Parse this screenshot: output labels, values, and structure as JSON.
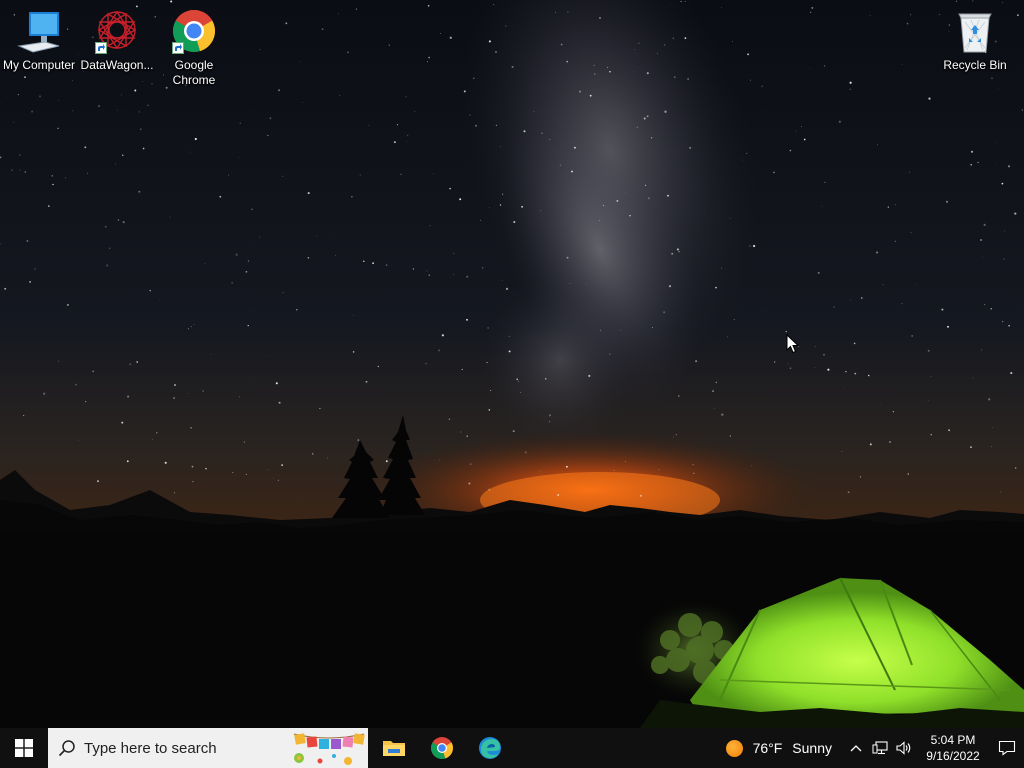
{
  "desktop": {
    "icons": [
      {
        "label": "My Computer",
        "icon": "monitor-icon"
      },
      {
        "label": "DataWagon...",
        "icon": "datawagon-icon"
      },
      {
        "label": "Google Chrome",
        "icon": "chrome-icon"
      },
      {
        "label": "Recycle Bin",
        "icon": "recycle-bin-icon"
      }
    ]
  },
  "taskbar": {
    "start_icon": "windows-logo-icon",
    "search_placeholder": "Type here to search",
    "pinned": [
      {
        "name": "File Explorer",
        "icon": "folder-icon"
      },
      {
        "name": "Google Chrome",
        "icon": "chrome-icon"
      },
      {
        "name": "Microsoft Edge",
        "icon": "edge-icon"
      }
    ],
    "weather": {
      "temp": "76°F",
      "condition": "Sunny"
    },
    "clock": {
      "time": "5:04 PM",
      "date": "9/16/2022"
    }
  },
  "colors": {
    "taskbar_bg": "#101010",
    "search_bg": "#f0f0f0",
    "tent_green": "#8ee52a",
    "horizon_glow": "#e8601a"
  }
}
